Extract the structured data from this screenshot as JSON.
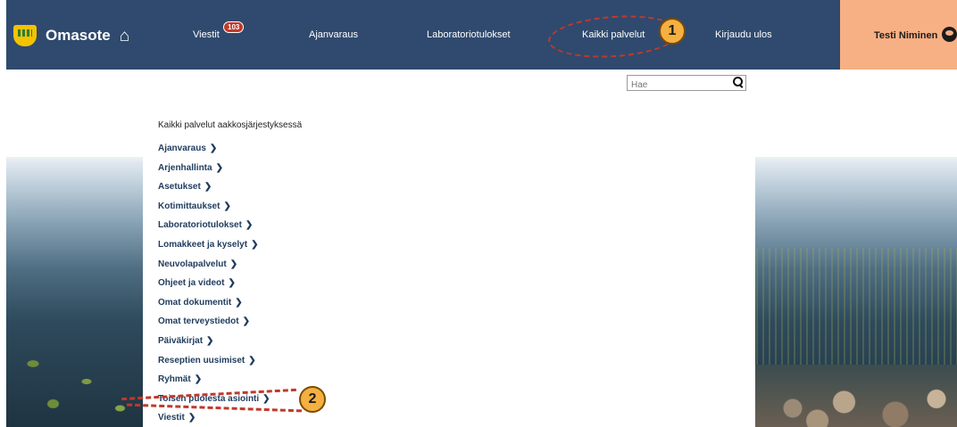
{
  "header": {
    "brand": "Omasote",
    "nav": [
      {
        "label": "Viestit",
        "badge": "103"
      },
      {
        "label": "Ajanvaraus"
      },
      {
        "label": "Laboratoriotulokset"
      },
      {
        "label": "Kaikki palvelut"
      },
      {
        "label": "Kirjaudu ulos"
      }
    ],
    "user_name": "Testi Niminen"
  },
  "search": {
    "placeholder": "Hae"
  },
  "panel": {
    "title": "Kaikki palvelut aakkosjärjestyksessä",
    "services": [
      "Ajanvaraus",
      "Arjenhallinta",
      "Asetukset",
      "Kotimittaukset",
      "Laboratoriotulokset",
      "Lomakkeet ja kyselyt",
      "Neuvolapalvelut",
      "Ohjeet ja videot",
      "Omat dokumentit",
      "Omat terveystiedot",
      "Päiväkirjat",
      "Reseptien uusimiset",
      "Ryhmät",
      "Toisen puolesta asiointi",
      "Viestit"
    ]
  },
  "annotations": [
    "1",
    "2"
  ],
  "colors": {
    "header_bg": "#2f4a6e",
    "user_bg": "#f7b083",
    "annotation": "#c0392b",
    "badge": "#c0392b"
  }
}
